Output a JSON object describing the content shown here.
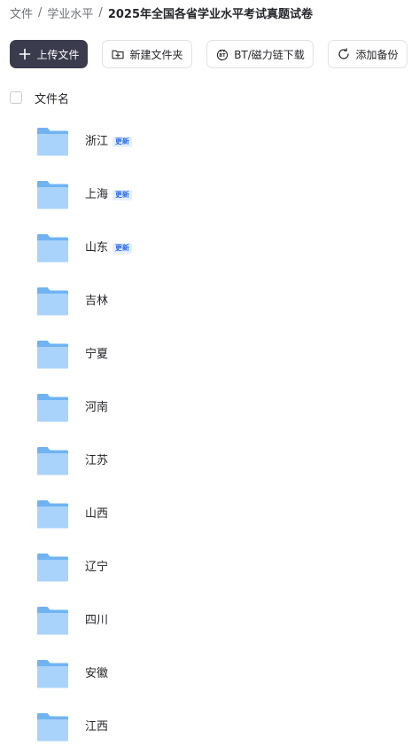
{
  "breadcrumb": {
    "items": [
      "文件",
      "学业水平"
    ],
    "separator": "/",
    "current": "2025年全国各省学业水平考试真题试卷"
  },
  "toolbar": {
    "upload_label": "上传文件",
    "new_folder_label": "新建文件夹",
    "bt_label": "BT/磁力链下载",
    "backup_label": "添加备份"
  },
  "list": {
    "header_label": "文件名",
    "update_badge": "更新",
    "items": [
      {
        "name": "浙江",
        "updated": true
      },
      {
        "name": "上海",
        "updated": true
      },
      {
        "name": "山东",
        "updated": true
      },
      {
        "name": "吉林",
        "updated": false
      },
      {
        "name": "宁夏",
        "updated": false
      },
      {
        "name": "河南",
        "updated": false
      },
      {
        "name": "江苏",
        "updated": false
      },
      {
        "name": "山西",
        "updated": false
      },
      {
        "name": "辽宁",
        "updated": false
      },
      {
        "name": "四川",
        "updated": false
      },
      {
        "name": "安徽",
        "updated": false
      },
      {
        "name": "江西",
        "updated": false
      }
    ]
  },
  "colors": {
    "primary_button": "#3a3b4d",
    "folder_light": "#a9d3fb",
    "folder_dark": "#6fb3f3",
    "badge_bg": "#e4efff",
    "badge_text": "#2b6be6"
  },
  "icons": {
    "upload": "plus-icon",
    "new_folder": "folder-plus-icon",
    "bt": "bt-download-icon",
    "backup": "refresh-circle-icon",
    "folder": "folder-icon"
  }
}
